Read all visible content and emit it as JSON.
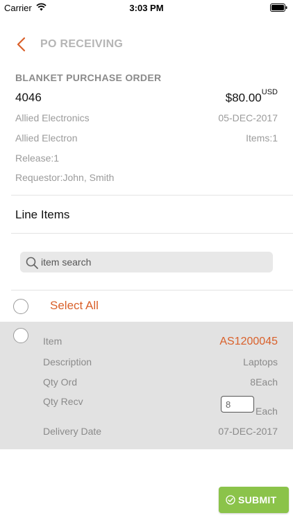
{
  "status_bar": {
    "carrier": "Carrier",
    "time": "3:03 PM"
  },
  "nav": {
    "title": "PO RECEIVING"
  },
  "po": {
    "type": "BLANKET PURCHASE ORDER",
    "number": "4046",
    "amount": "$80.00",
    "currency": "USD",
    "supplier": "Allied Electronics",
    "date": "05-DEC-2017",
    "site": "Allied Electron",
    "items": "Items:1",
    "release": "Release:1",
    "requestor": "Requestor:John, Smith"
  },
  "line_items": {
    "heading": "Line Items",
    "search_placeholder": "item search",
    "select_all": "Select All",
    "items": [
      {
        "item_label": "Item",
        "item_value": "AS1200045",
        "description_label": "Description",
        "description_value": "Laptops",
        "qty_ord_label": "Qty Ord",
        "qty_ord_value": "8Each",
        "qty_recv_label": "Qty Recv",
        "qty_recv_value": "8",
        "qty_recv_unit": "Each",
        "delivery_label": "Delivery Date",
        "delivery_value": "07-DEC-2017"
      }
    ]
  },
  "actions": {
    "submit": "SUBMIT"
  },
  "colors": {
    "accent": "#d9602a",
    "submit_green": "#8bc34a",
    "card_gray": "#e2e2e2"
  },
  "icons": [
    "wifi-icon",
    "battery-icon",
    "back-chevron-icon",
    "search-icon",
    "check-circle-icon"
  ]
}
